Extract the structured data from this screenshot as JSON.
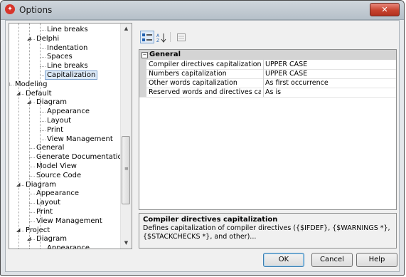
{
  "window": {
    "title": "Options",
    "app_icon": "app-icon",
    "close_label": "✕"
  },
  "tree": {
    "nodes": [
      {
        "label": "Line breaks",
        "level": 3
      },
      {
        "label": "Delphi",
        "level": 2,
        "expanded": true
      },
      {
        "label": "Indentation",
        "level": 3
      },
      {
        "label": "Spaces",
        "level": 3
      },
      {
        "label": "Line breaks",
        "level": 3
      },
      {
        "label": "Capitalization",
        "level": 3,
        "selected": true
      },
      {
        "label": "Modeling",
        "level": 0,
        "expanded": true
      },
      {
        "label": "Default",
        "level": 1,
        "expanded": true
      },
      {
        "label": "Diagram",
        "level": 2,
        "expanded": true
      },
      {
        "label": "Appearance",
        "level": 3
      },
      {
        "label": "Layout",
        "level": 3
      },
      {
        "label": "Print",
        "level": 3
      },
      {
        "label": "View Management",
        "level": 3
      },
      {
        "label": "General",
        "level": 2
      },
      {
        "label": "Generate Documentation",
        "level": 2
      },
      {
        "label": "Model View",
        "level": 2
      },
      {
        "label": "Source Code",
        "level": 2
      },
      {
        "label": "Diagram",
        "level": 1,
        "expanded": true
      },
      {
        "label": "Appearance",
        "level": 2
      },
      {
        "label": "Layout",
        "level": 2
      },
      {
        "label": "Print",
        "level": 2
      },
      {
        "label": "View Management",
        "level": 2
      },
      {
        "label": "Project",
        "level": 1,
        "expanded": true
      },
      {
        "label": "Diagram",
        "level": 2,
        "expanded": true
      },
      {
        "label": "Appearance",
        "level": 3
      }
    ]
  },
  "toolbar": {
    "categorized_icon": "categorized-icon",
    "alphabetical_icon": "sort-alphabetical-icon",
    "property_pages_icon": "property-pages-icon"
  },
  "grid": {
    "category": "General",
    "rows": [
      {
        "name": "Compiler directives capitalization",
        "value": "UPPER CASE"
      },
      {
        "name": "Numbers capitalization",
        "value": "UPPER CASE"
      },
      {
        "name": "Other words capitalization",
        "value": "As first occurrence"
      },
      {
        "name": "Reserved words and directives capitaliz",
        "value": "As is"
      }
    ]
  },
  "description": {
    "title": "Compiler directives capitalization",
    "text": "Defines capitalization of compiler directives ({$IFDEF}, {$WARNINGS *}, {$STACKCHECKS *}, and other)..."
  },
  "buttons": {
    "ok": "OK",
    "cancel": "Cancel",
    "help": "Help"
  }
}
